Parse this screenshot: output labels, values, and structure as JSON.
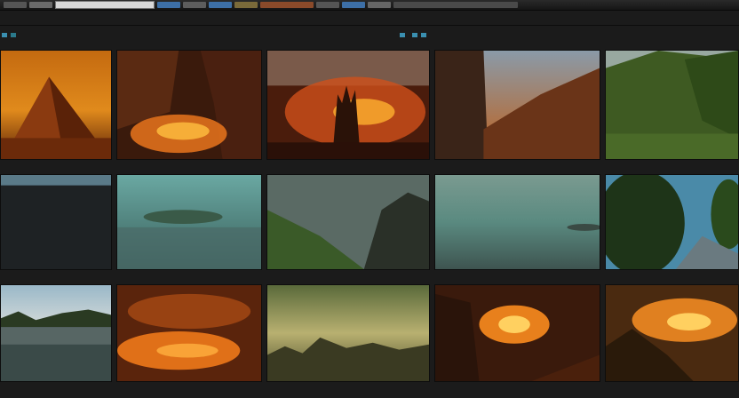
{
  "window": {
    "title": ""
  },
  "toolbar": {
    "label_left": "",
    "label_mid": "",
    "label_right": ""
  },
  "thumbnails": [
    {
      "caption": "",
      "scene": "desert-pyramid"
    },
    {
      "caption": "",
      "scene": "lava-cliff"
    },
    {
      "caption": "",
      "scene": "fire-ruins"
    },
    {
      "caption": "",
      "scene": "canyon-dusk"
    },
    {
      "caption": "",
      "scene": "mossy-cliff"
    },
    {
      "caption": "",
      "scene": "dark-lake"
    },
    {
      "caption": "",
      "scene": "teal-island"
    },
    {
      "caption": "",
      "scene": "foggy-hill"
    },
    {
      "caption": "",
      "scene": "misty-sea"
    },
    {
      "caption": "",
      "scene": "forest-arch"
    },
    {
      "caption": "",
      "scene": "calm-lake"
    },
    {
      "caption": "",
      "scene": "lava-field"
    },
    {
      "caption": "",
      "scene": "green-haze"
    },
    {
      "caption": "",
      "scene": "fire-burst"
    },
    {
      "caption": "",
      "scene": "sunset-rocks"
    }
  ],
  "colors": {
    "accent": "#3a8fb0",
    "background": "#1b1b1b"
  }
}
